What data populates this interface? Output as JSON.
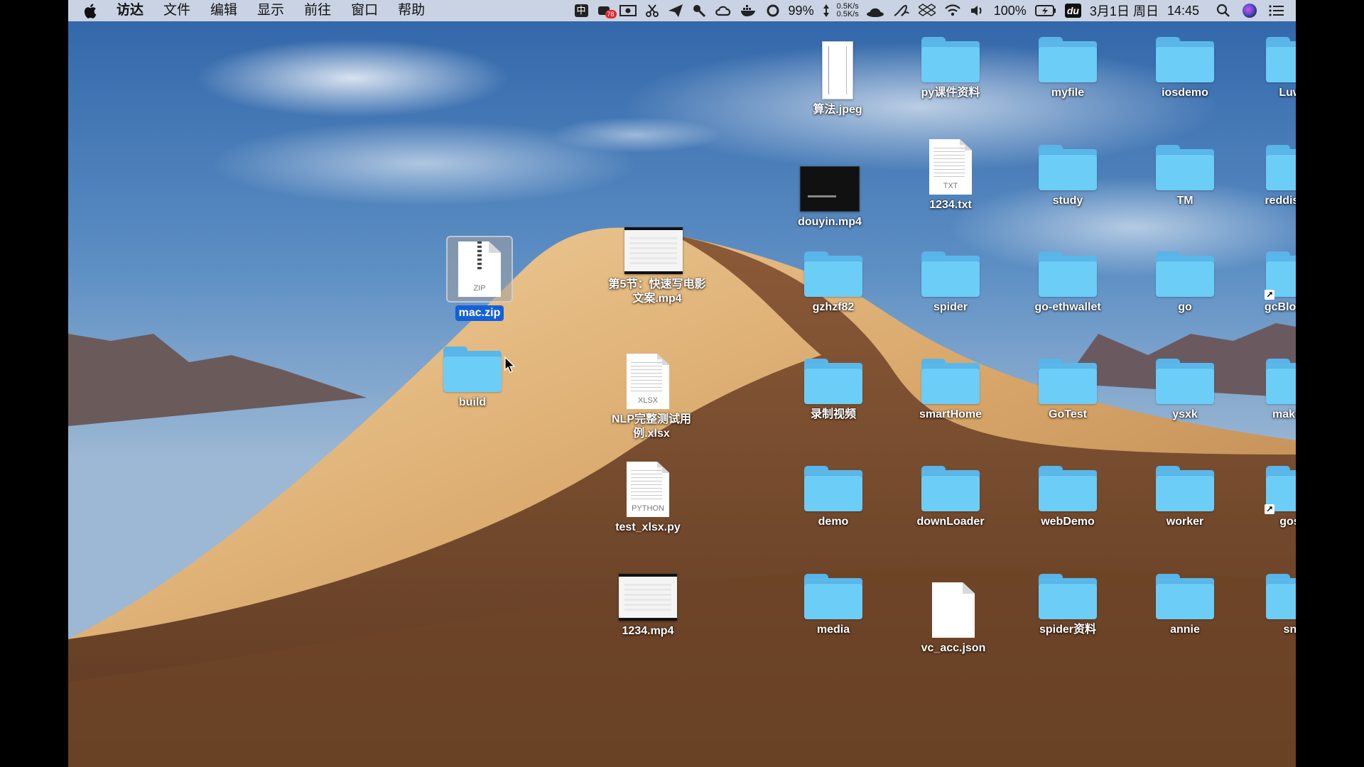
{
  "menubar": {
    "apple": "apple-icon",
    "items": [
      "访达",
      "文件",
      "编辑",
      "显示",
      "前往",
      "窗口",
      "帮助"
    ],
    "input_method": "中",
    "badge_count": "78",
    "battery_small": "99%",
    "net_up": "0.5K/s",
    "net_down": "0.5K/s",
    "battery": "100%",
    "du_label": "du",
    "date": "3月1日 周日",
    "time": "14:45"
  },
  "desktop": {
    "selected_file": "mac.zip",
    "build": "build",
    "video_lesson": "第5节：快速写电影文案.mp4",
    "xlsx": "NLP完整测试用例.xlsx",
    "xlsx_ext": "XLSX",
    "py": "test_xlsx.py",
    "py_ext": "PYTHON",
    "mp4_1234": "1234.mp4",
    "jpeg": "算法.jpeg",
    "douyin": "douyin.mp4",
    "txt": "1234.txt",
    "txt_ext": "TXT",
    "zip_ext": "ZIP",
    "json": "vc_acc.json",
    "folders": {
      "py_materials": "py课件资料",
      "myfile": "myfile",
      "iosdemo": "iosdemo",
      "luwei": "Luwei",
      "study": "study",
      "tm": "TM",
      "reddis_test": "reddis_test",
      "gzhzf82": "gzhzf82",
      "spider": "spider",
      "go_ethwallet": "go-ethwallet",
      "go": "go",
      "gcblog": "gcBlog文章",
      "recordings": "录制视频",
      "smarthome": "smartHome",
      "gotest": "GoTest",
      "ysxk": "ysxk",
      "makefile": "makefile",
      "demo": "demo",
      "downloader": "downLoader",
      "webdemo": "webDemo",
      "worker": "worker",
      "gosrc": "gosrc",
      "media": "media",
      "spider_materials": "spider资料",
      "annie": "annie",
      "snip": "snip"
    }
  }
}
